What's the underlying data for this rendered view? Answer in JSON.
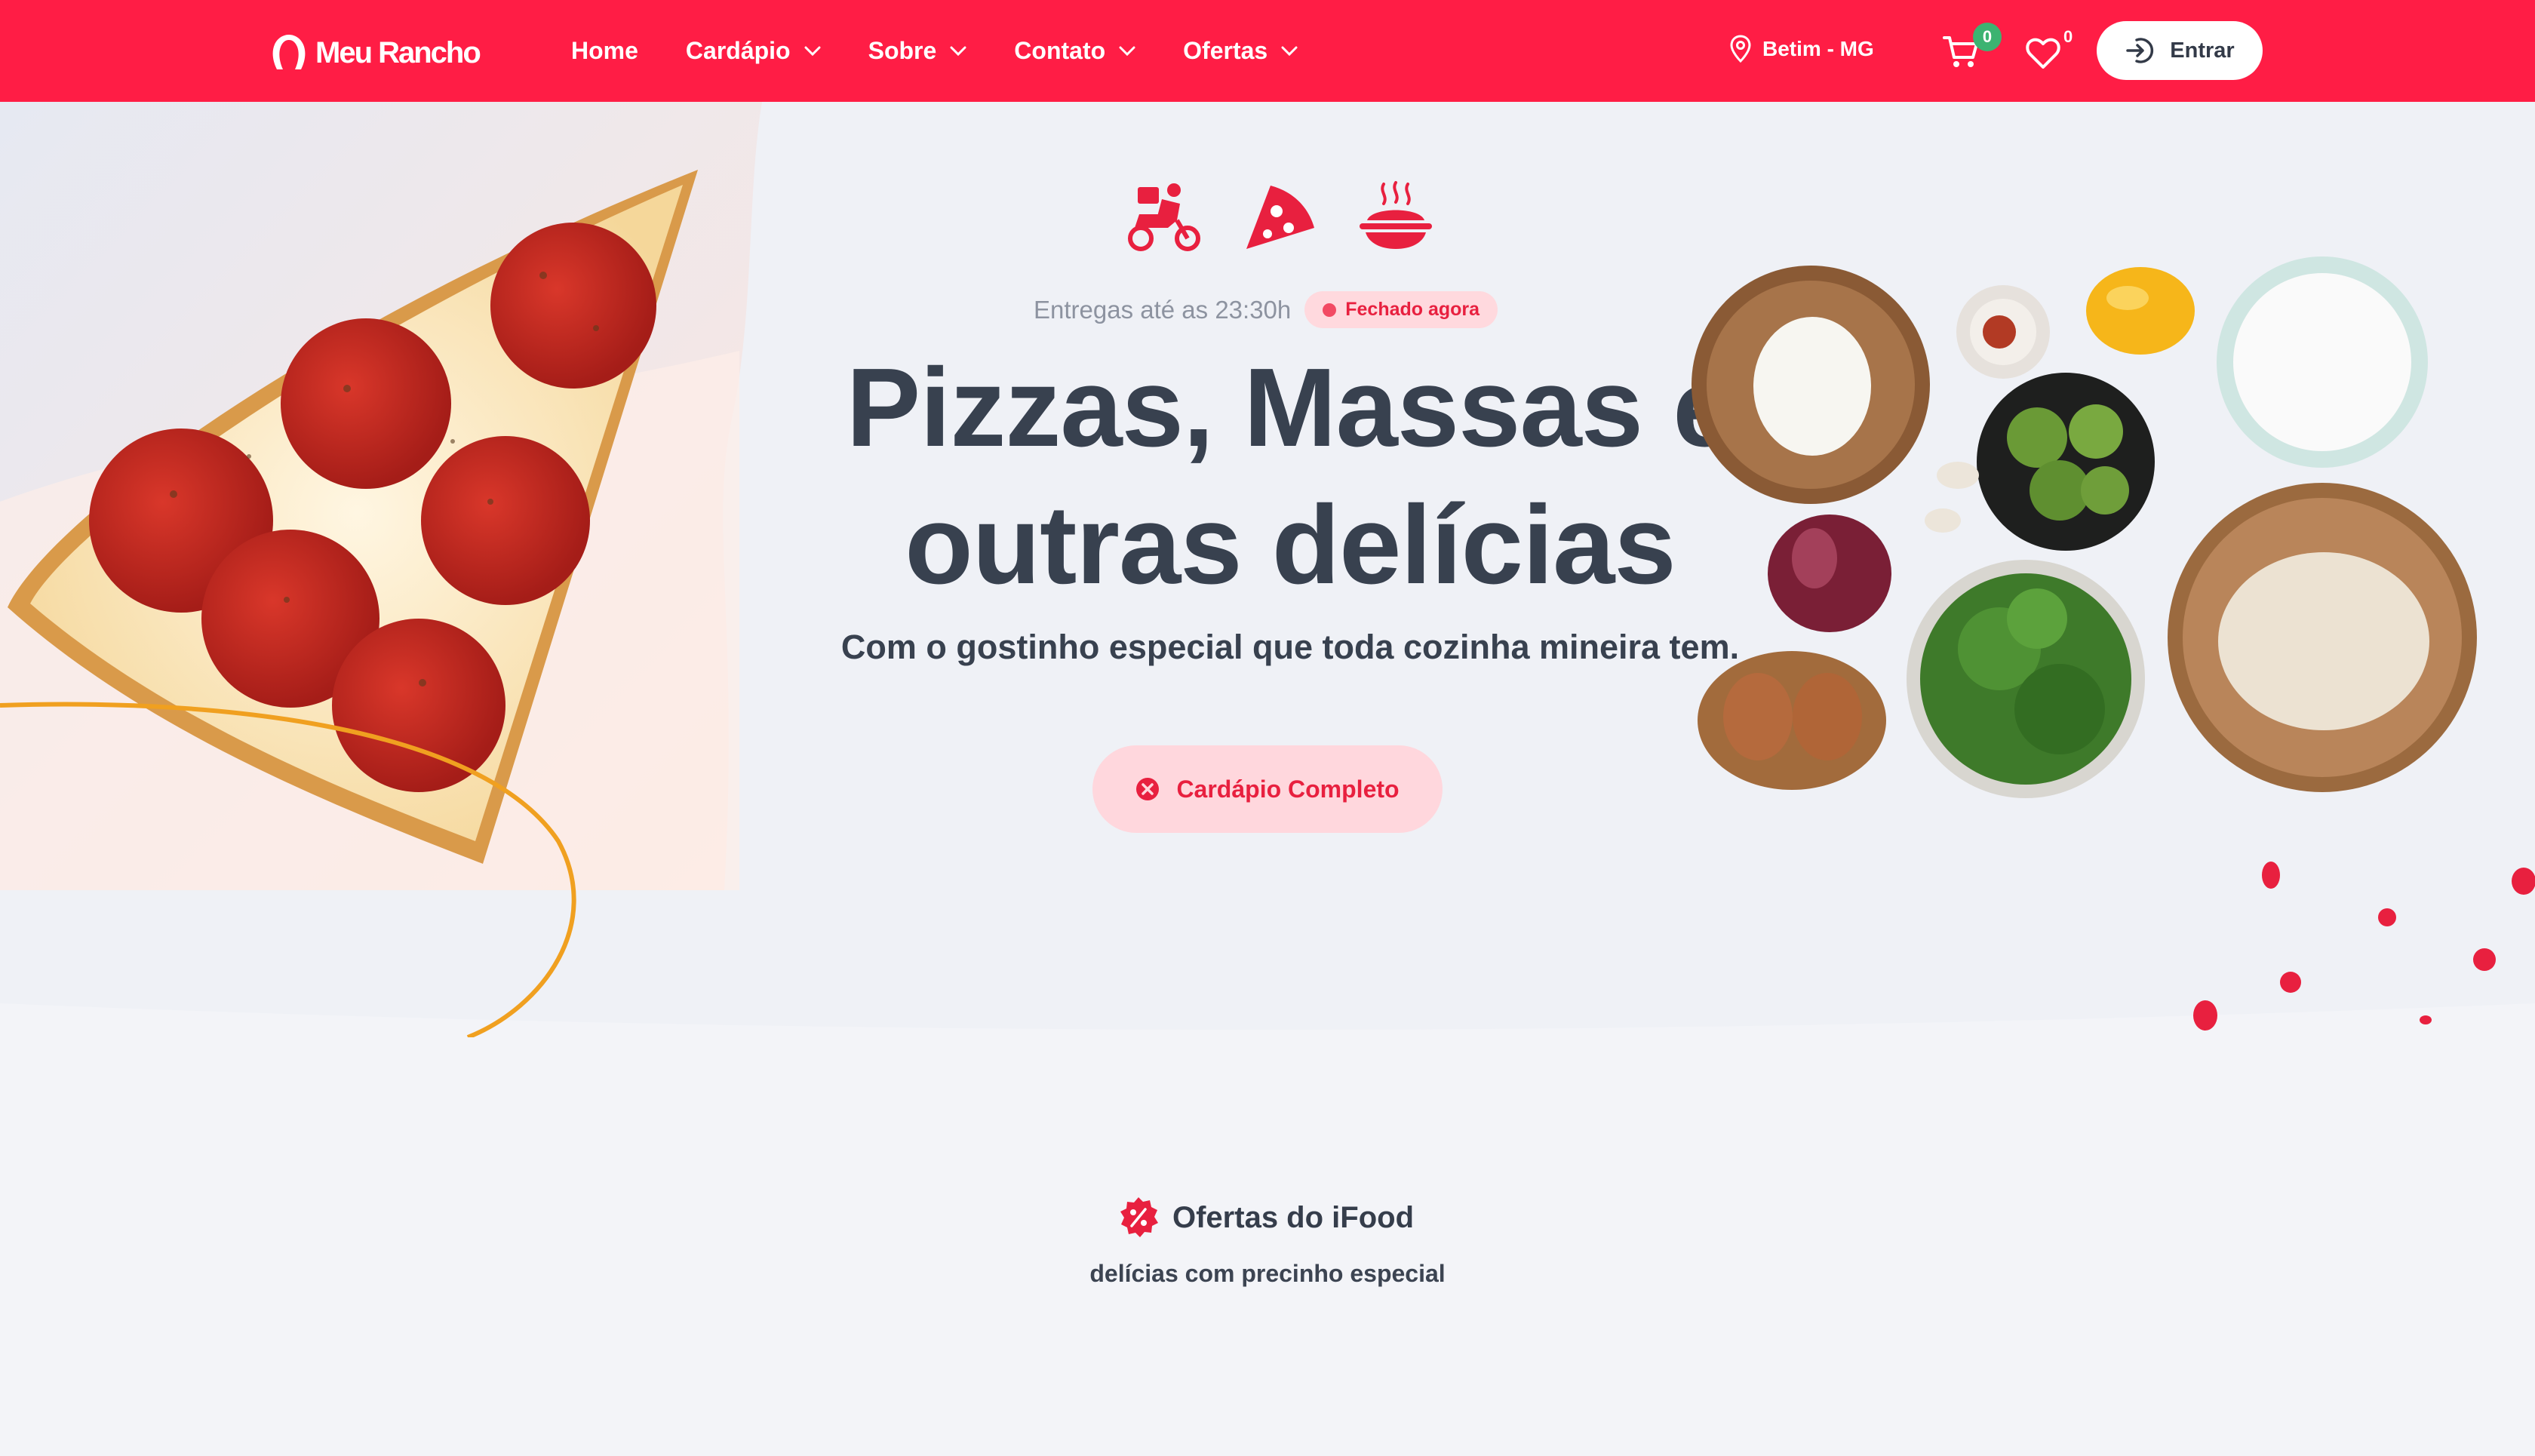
{
  "brand": {
    "name": "Meu Rancho",
    "color": "#ff1d45"
  },
  "nav": {
    "items": [
      {
        "label": "Home",
        "has_dropdown": false
      },
      {
        "label": "Cardápio",
        "has_dropdown": true
      },
      {
        "label": "Sobre",
        "has_dropdown": true
      },
      {
        "label": "Contato",
        "has_dropdown": true
      },
      {
        "label": "Ofertas",
        "has_dropdown": true
      }
    ]
  },
  "header": {
    "location": "Betim - MG",
    "cart_count": "0",
    "favorites_count": "0",
    "login_label": "Entrar"
  },
  "hero": {
    "icons": [
      "delivery-scooter-icon",
      "pizza-slice-icon",
      "pasta-bowl-icon"
    ],
    "delivery_text": "Entregas até as 23:30h",
    "status": "Fechado agora",
    "title": "Pizzas, Massas e outras delícias",
    "subtitle": "Com o gostinho especial que toda cozinha mineira tem.",
    "cta_label": "Cardápio Completo"
  },
  "offers": {
    "title": "Ofertas do iFood",
    "subtitle": "delícias com precinho especial",
    "icon": "discount-badge-icon"
  },
  "colors": {
    "accent": "#ff1d45",
    "text_dark": "#38414f",
    "badge_bg": "#ffd9de",
    "cart_badge": "#3cb371",
    "background": "#eff1f6"
  }
}
